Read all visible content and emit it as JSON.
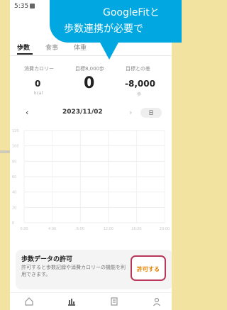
{
  "status_bar": {
    "time": "5:35"
  },
  "tabs": [
    {
      "label": "歩数",
      "active": true
    },
    {
      "label": "食事",
      "active": false
    },
    {
      "label": "体重",
      "active": false
    }
  ],
  "metrics": {
    "calories": {
      "label": "消費カロリー",
      "value": "0",
      "unit": "kcal"
    },
    "goal_steps": {
      "label": "目標8,000歩",
      "value": "0"
    },
    "goal_diff": {
      "label": "目標との差",
      "value": "-8,000",
      "unit": "歩"
    }
  },
  "date_nav": {
    "date": "2023/11/02",
    "period_button": "日"
  },
  "chart_data": {
    "type": "bar",
    "x_ticks": [
      "0:00",
      "4:00",
      "8:00",
      "12:00",
      "16:00",
      "20:00"
    ],
    "y_ticks": [
      "120",
      "100",
      "80",
      "60",
      "40",
      "20",
      "0"
    ],
    "values": [],
    "grid": true
  },
  "permission": {
    "title": "歩数データの許可",
    "description": "許可すると歩数記録や消費カロリーの機能を利用できます。",
    "button": "許可する"
  },
  "callout": {
    "line1": "GoogleFitと",
    "line2": "歩数連携が必要で"
  },
  "colors": {
    "accent": "#e58200",
    "highlight_border": "#b8375a",
    "callout": "#00a7e1",
    "background": "#f3e3a0"
  },
  "bottom_nav": [
    "home-icon",
    "chart-icon",
    "notes-icon",
    "profile-icon"
  ]
}
